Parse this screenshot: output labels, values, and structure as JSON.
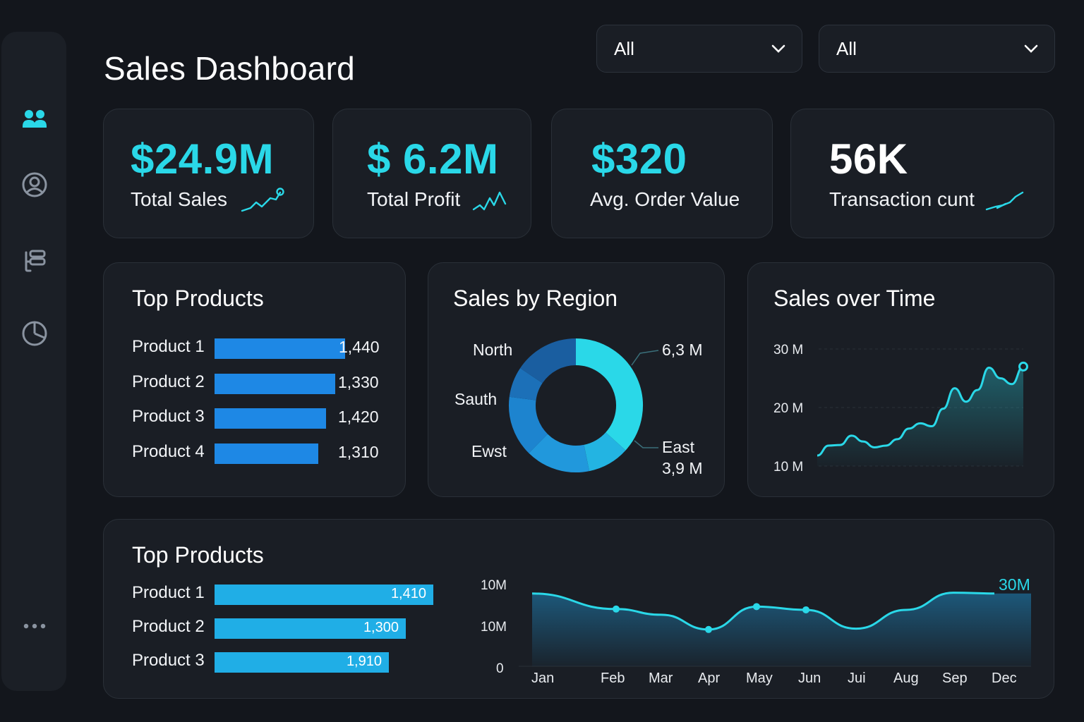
{
  "page": {
    "title": "Sales Dashboard"
  },
  "filters": [
    {
      "value": "All"
    },
    {
      "value": "All"
    }
  ],
  "colors": {
    "accent": "#2ad8e8",
    "bar_primary": "#1e88e5",
    "bar_secondary": "#20aee6",
    "background": "#13161c",
    "card": "#1a1e25"
  },
  "sidebar": {
    "items": [
      {
        "icon": "users-icon",
        "active": true
      },
      {
        "icon": "user-profile-icon",
        "active": false
      },
      {
        "icon": "list-icon",
        "active": false
      },
      {
        "icon": "pie-chart-icon",
        "active": false
      },
      {
        "icon": "more-icon",
        "active": false
      }
    ]
  },
  "kpis": [
    {
      "value": "$24.9M",
      "label": "Total Sales",
      "icon": "trend-up-icon",
      "value_color": "#2ad8e8"
    },
    {
      "value": "$ 6.2M",
      "label": "Total Profit",
      "icon": "trend-zigzag-icon",
      "value_color": "#2ad8e8"
    },
    {
      "value": "$320",
      "label": "Avg. Order Value",
      "icon": "",
      "value_color": "#2ad8e8"
    },
    {
      "value": "56K",
      "label": "Transaction cunt",
      "icon": "trend-up-icon",
      "value_color": "#ffffff"
    }
  ],
  "top_products": {
    "title": "Top Products",
    "items": [
      {
        "label": "Product 1",
        "value_text": "1,440"
      },
      {
        "label": "Product 2",
        "value_text": "1,330"
      },
      {
        "label": "Product 3",
        "value_text": "1,420"
      },
      {
        "label": "Product 4",
        "value_text": "1,310"
      }
    ]
  },
  "sales_by_region": {
    "title": "Sales by Region",
    "labels": {
      "north": "North",
      "south": "Sauth",
      "west": "Ewst",
      "north_value": "6,3 M",
      "east": "East",
      "east_value": "3,9 M"
    }
  },
  "sales_over_time": {
    "title": "Sales over Time",
    "yticks": [
      "30 M",
      "20 M",
      "10 M"
    ]
  },
  "top_products_bottom": {
    "title": "Top Products",
    "items": [
      {
        "label": "Product 1",
        "value_text": "1,410"
      },
      {
        "label": "Product 2",
        "value_text": "1,300"
      },
      {
        "label": "Product 3",
        "value_text": "1,910"
      }
    ]
  },
  "bottom_chart": {
    "yticks": [
      "10M",
      "10M",
      "0"
    ],
    "end_label": "30M",
    "months": [
      "Jan",
      "Feb",
      "Mar",
      "Apr",
      "May",
      "Jun",
      "Jui",
      "Aug",
      "Sep",
      "Dec"
    ]
  },
  "chart_data": [
    {
      "type": "bar",
      "title": "Top Products",
      "orientation": "horizontal",
      "categories": [
        "Product 1",
        "Product 2",
        "Product 3",
        "Product 4"
      ],
      "values": [
        1440,
        1330,
        1420,
        1310
      ],
      "color": "#1e88e5"
    },
    {
      "type": "pie",
      "title": "Sales by Region",
      "donut": true,
      "slices": [
        {
          "name": "East",
          "value": 40,
          "color": "#2ad8e8"
        },
        {
          "name": "",
          "value": 11,
          "color": "#23b4e2"
        },
        {
          "name": "",
          "value": 17,
          "color": "#2198dc"
        },
        {
          "name": "",
          "value": 16,
          "color": "#1d84cf"
        },
        {
          "name": "",
          "value": 8,
          "color": "#1c70b8"
        },
        {
          "name": "North",
          "value": 17,
          "color": "#1a5ea0"
        }
      ]
    },
    {
      "type": "area",
      "title": "Sales over Time",
      "ylim": [
        10,
        30
      ],
      "yunit": "M",
      "x": [
        0,
        1,
        2,
        3,
        4,
        5,
        6,
        7,
        8,
        9,
        10,
        11,
        12,
        13,
        14,
        15,
        16,
        17,
        18
      ],
      "values": [
        11.8,
        13.5,
        13.6,
        15.2,
        14.2,
        13.2,
        13.5,
        14.6,
        16.4,
        17.3,
        16.8,
        19.8,
        23.3,
        21.0,
        23.0,
        26.8,
        25.0,
        24.0,
        27.0
      ],
      "color": "#2ad8e8"
    },
    {
      "type": "bar",
      "title": "Top Products",
      "orientation": "horizontal",
      "categories": [
        "Product 1",
        "Product 2",
        "Product 3"
      ],
      "values": [
        1410,
        1300,
        1910
      ],
      "color": "#20aee6"
    },
    {
      "type": "area",
      "categories": [
        "Jan",
        "Feb",
        "Mar",
        "Apr",
        "May",
        "Jun",
        "Jui",
        "Aug",
        "Sep",
        "Dec"
      ],
      "yticks": [
        "10M",
        "10M",
        "0"
      ],
      "end_label": "30M",
      "values": [
        8.9,
        7.0,
        6.3,
        4.5,
        7.3,
        6.9,
        4.6,
        6.9,
        9.0,
        8.9
      ],
      "markers": [
        "Feb",
        "Apr",
        "May",
        "Jun"
      ],
      "color": "#2ad8e8"
    }
  ]
}
